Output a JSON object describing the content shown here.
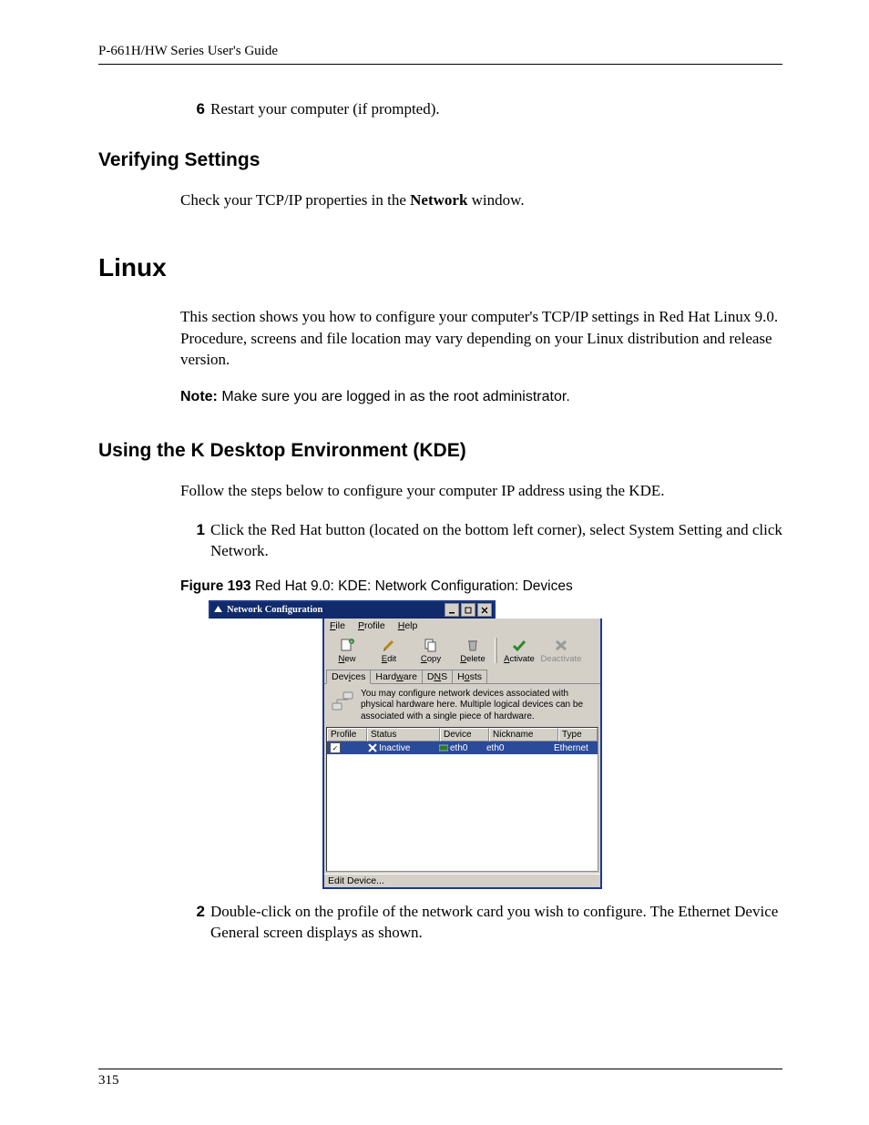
{
  "header": {
    "running": "P-661H/HW Series User's Guide"
  },
  "step6": {
    "num": "6",
    "text": "Restart your computer (if prompted)."
  },
  "verify": {
    "heading": "Verifying Settings",
    "text_pre": "Check your TCP/IP properties in the ",
    "text_bold": "Network",
    "text_post": " window."
  },
  "linux": {
    "heading": "Linux",
    "para": "This section shows you how to configure your computer's TCP/IP settings in Red Hat Linux 9.0. Procedure, screens and file location may vary depending on your Linux distribution and release version.",
    "note_label": "Note:",
    "note_text": " Make sure you are logged in as the root administrator."
  },
  "kde": {
    "heading": "Using the K Desktop Environment (KDE)",
    "intro": "Follow the steps below to configure your computer IP address using the KDE.",
    "step1": {
      "num": "1",
      "t1": "Click the Red Hat button (located on the bottom left corner), select ",
      "b1": "System Setting",
      "t2": " and click ",
      "b2": "Network",
      "t3": "."
    },
    "figcap": {
      "label": "Figure 193",
      "text": "   Red Hat 9.0: KDE: Network Configuration: Devices"
    },
    "step2": {
      "num": "2",
      "t1": "Double-click on the profile of the network card you wish to configure. The ",
      "b1": "Ethernet Device General",
      "t2": " screen displays as shown."
    }
  },
  "window": {
    "title": "Network Configuration",
    "menu": {
      "file": "File",
      "profile": "Profile",
      "help": "Help"
    },
    "toolbar": {
      "new": "New",
      "edit": "Edit",
      "copy": "Copy",
      "delete": "Delete",
      "activate": "Activate",
      "deactivate": "Deactivate"
    },
    "tabs": {
      "devices": "Devices",
      "hardware": "Hardware",
      "dns": "DNS",
      "hosts": "Hosts"
    },
    "info": "You may configure network devices associated with physical hardware here. Multiple logical devices can be associated with a single piece of hardware.",
    "columns": {
      "profile": "Profile",
      "status": "Status",
      "device": "Device",
      "nickname": "Nickname",
      "type": "Type"
    },
    "row": {
      "status": "Inactive",
      "device": "eth0",
      "nickname": "eth0",
      "type": "Ethernet"
    },
    "statusbar": "Edit Device..."
  },
  "footer": {
    "page": "315"
  }
}
